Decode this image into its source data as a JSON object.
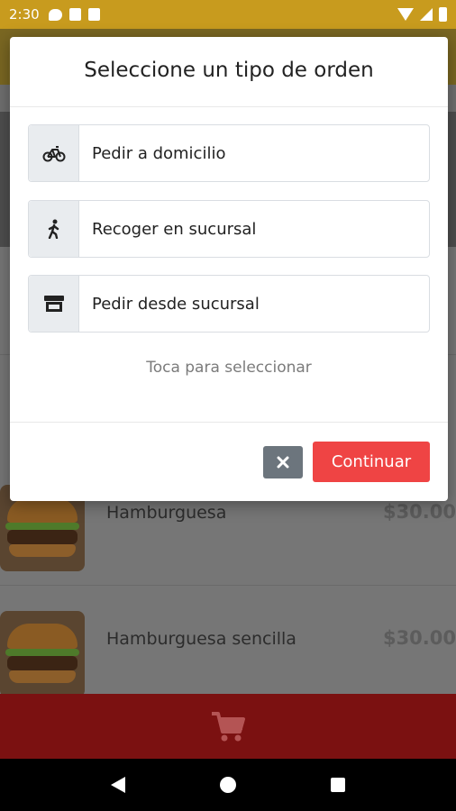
{
  "status_bar": {
    "time": "2:30",
    "icons": [
      "chat-icon",
      "sd-card-icon",
      "storage-icon",
      "wifi-icon",
      "signal-icon",
      "battery-icon"
    ]
  },
  "products": [
    {
      "name": "Hamburguesa",
      "price": "$30.00"
    },
    {
      "name": "Hamburguesa sencilla",
      "price": "$30.00"
    }
  ],
  "modal": {
    "title": "Seleccione un tipo de orden",
    "options": [
      {
        "label": "Pedir a domicilio",
        "icon": "bicycle-icon"
      },
      {
        "label": "Recoger en sucursal",
        "icon": "walking-icon"
      },
      {
        "label": "Pedir desde sucursal",
        "icon": "store-icon"
      }
    ],
    "hint": "Toca para seleccionar",
    "close_icon": "close-icon",
    "continue_label": "Continuar"
  },
  "colors": {
    "accent": "#ef4444",
    "status_bar": "#c89b1e",
    "cart_bar": "#7b1111",
    "secondary_button": "#6c757d"
  }
}
